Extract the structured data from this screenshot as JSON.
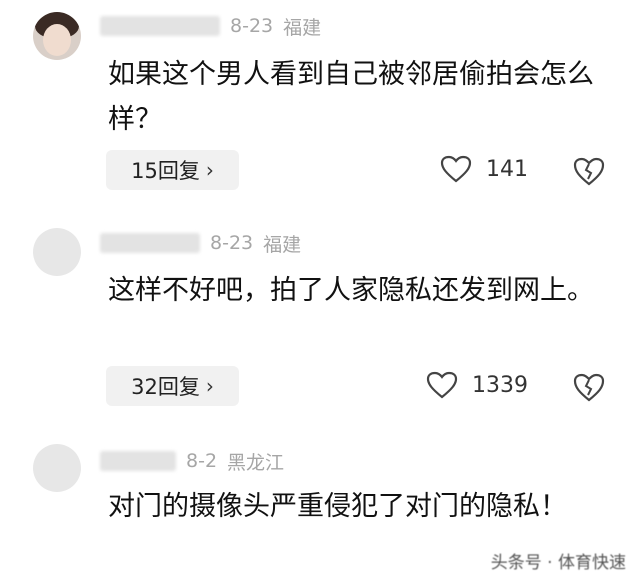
{
  "comments": [
    {
      "date": "8-23",
      "location": "福建",
      "text": "如果这个男人看到自己被邻居偷拍会怎么样？",
      "replies": "15回复",
      "likes": "141"
    },
    {
      "date": "8-23",
      "location": "福建",
      "text": "这样不好吧，拍了人家隐私还发到网上。",
      "replies": "32回复",
      "likes": "1339"
    },
    {
      "date": "8-2",
      "location": "黑龙江",
      "text": "对门的摄像头严重侵犯了对门的隐私！"
    }
  ],
  "watermark": "头条号 · 体育快速",
  "icons": {
    "like": "heart-outline-icon",
    "dislike": "broken-heart-icon",
    "reply_arrow": "chevron-right-icon"
  },
  "colors": {
    "meta_text": "#a6a6a6",
    "button_bg": "#f1f1f1"
  }
}
